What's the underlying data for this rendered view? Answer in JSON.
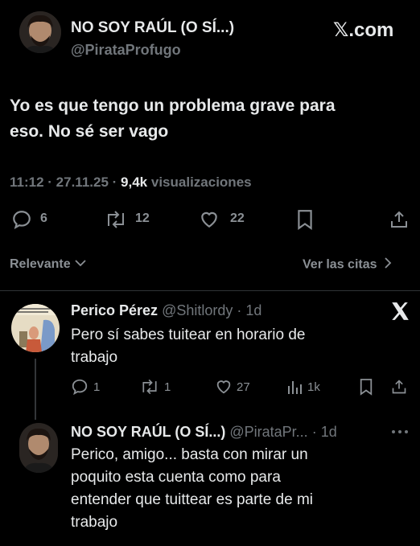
{
  "post": {
    "author_name": "NO SOY RAÚL (O SÍ...)",
    "author_handle": "@PirataProfugo",
    "brand": "𝕏.com",
    "text_line1": "Yo es que tengo un problema grave para",
    "text_line2": "eso. No sé ser vago",
    "time": "11:12",
    "date": "27.11.25",
    "views": "9,4k",
    "views_label": "visualizaciones",
    "replies": "6",
    "reposts": "12",
    "likes": "22"
  },
  "filter": {
    "sort_label": "Relevante",
    "quotes_label": "Ver las citas"
  },
  "reply1": {
    "name": "Perico Pérez",
    "handle": "@Shitlordy",
    "age": "1d",
    "text_line1": "Pero sí sabes tuitear en horario de",
    "text_line2": "trabajo",
    "replies": "1",
    "reposts": "1",
    "likes": "27",
    "views": "1k"
  },
  "reply2": {
    "name": "NO SOY RAÚL (O SÍ...)",
    "handle": "@PirataPr...",
    "age": "1d",
    "text_line1": "Perico, amigo... basta con mirar un",
    "text_line2": "poquito esta cuenta como para",
    "text_line3": "entender que tuittear es parte de mi",
    "text_line4": "trabajo"
  },
  "icons": [
    "avatar",
    "x-logo",
    "reply-icon",
    "repost-icon",
    "like-icon",
    "bookmark-icon",
    "share-icon",
    "views-icon",
    "more-icon",
    "chevron-down-icon",
    "chevron-right-icon"
  ]
}
